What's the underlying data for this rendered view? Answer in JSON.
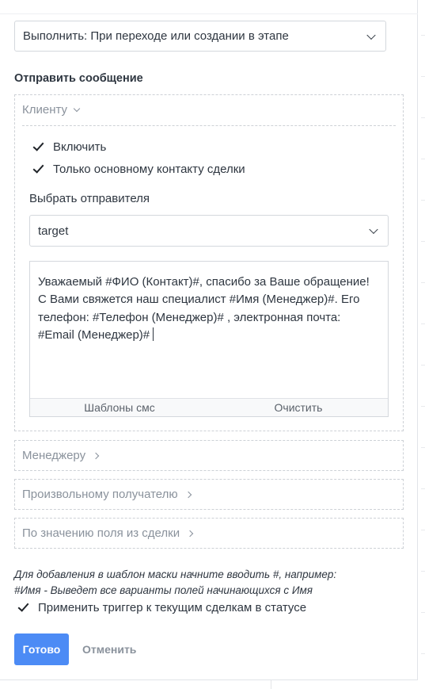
{
  "execute_select": {
    "value": "Выполнить: При переходе или создании в этапе"
  },
  "section_title": "Отправить сообщение",
  "client": {
    "header": "Клиенту",
    "enable_label": "Включить",
    "enable_checked": true,
    "main_contact_label": "Только основному контакту сделки",
    "main_contact_checked": true,
    "sender_label": "Выбрать отправителя",
    "sender_value": "target",
    "message_text": "Уважаемый #ФИО (Контакт)#, спасибо за Ваше обращение! С Вами свяжется наш специалист #Имя (Менеджер)#. Его телефон: #Телефон (Менеджер)# , электронная почта: #Email (Менеджер)#",
    "sms_templates_label": "Шаблоны смс",
    "clear_label": "Очистить"
  },
  "recipients": [
    {
      "label": "Менеджеру"
    },
    {
      "label": "Произвольному получателю"
    },
    {
      "label": "По значению поля из сделки"
    }
  ],
  "hint": {
    "line1": "Для добавления в шаблон маски начните вводить #, например:",
    "line2": "#Имя - Выведет все варианты полей начинающихся с Имя"
  },
  "apply_trigger": {
    "label": "Применить триггер к текущим сделкам в статусе",
    "checked": true
  },
  "buttons": {
    "done": "Готово",
    "cancel": "Отменить"
  },
  "colors": {
    "primary": "#4c8bf5",
    "muted": "#8a929c",
    "text": "#2e3640"
  }
}
